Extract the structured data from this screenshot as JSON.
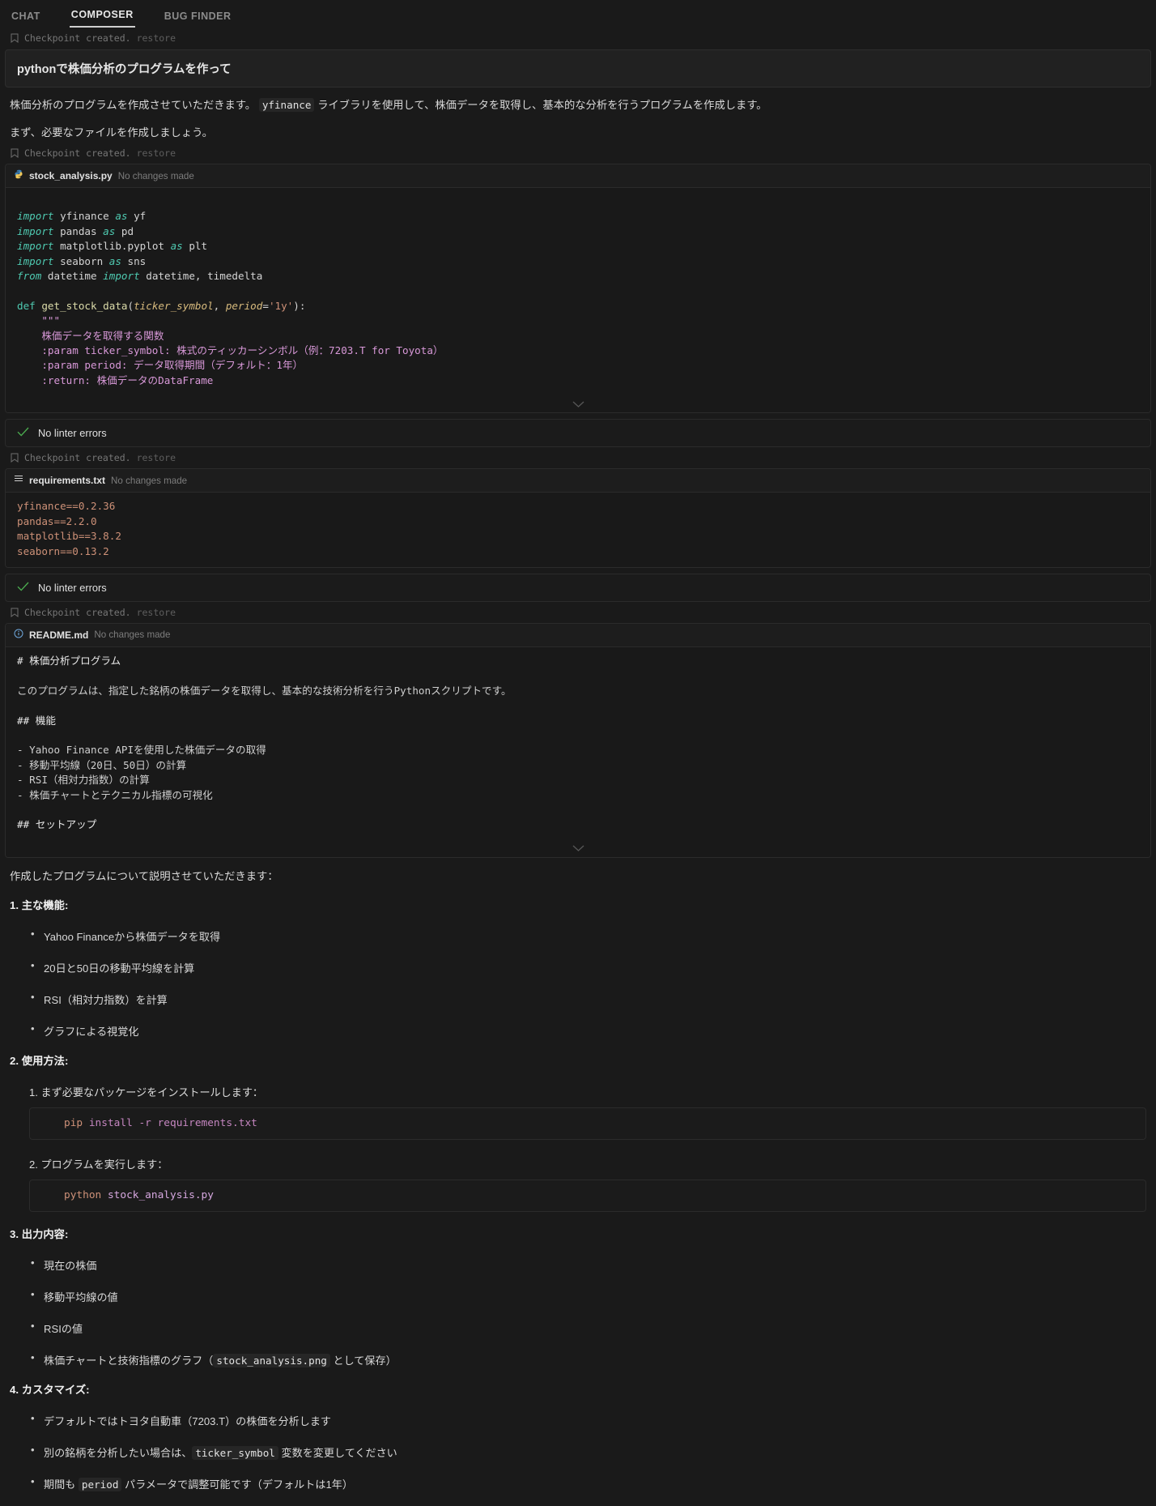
{
  "tabs": [
    {
      "label": "CHAT",
      "active": false
    },
    {
      "label": "COMPOSER",
      "active": true
    },
    {
      "label": "BUG FINDER",
      "active": false
    }
  ],
  "checkpoint": {
    "text": "Checkpoint created.",
    "restore": "restore"
  },
  "prompt": {
    "value": "pythonで株価分析のプログラムを作って"
  },
  "intro": {
    "line1_a": "株価分析のプログラムを作成させていただきます。",
    "line1_code": "yfinance",
    "line1_b": "ライブラリを使用して、株価データを取得し、基本的な分析を行うプログラムを作成します。",
    "line2": "まず、必要なファイルを作成しましょう。"
  },
  "files": [
    {
      "name": "stock_analysis.py",
      "status": "No changes made",
      "icon": "python-icon",
      "lines": [
        [
          {
            "t": "import",
            "c": "kw"
          },
          {
            "t": " yfinance ",
            "c": "pln"
          },
          {
            "t": "as",
            "c": "kw"
          },
          {
            "t": " yf",
            "c": "pln"
          }
        ],
        [
          {
            "t": "import",
            "c": "kw"
          },
          {
            "t": " pandas ",
            "c": "pln"
          },
          {
            "t": "as",
            "c": "kw"
          },
          {
            "t": " pd",
            "c": "pln"
          }
        ],
        [
          {
            "t": "import",
            "c": "kw"
          },
          {
            "t": " matplotlib.pyplot ",
            "c": "pln"
          },
          {
            "t": "as",
            "c": "kw"
          },
          {
            "t": " plt",
            "c": "pln"
          }
        ],
        [
          {
            "t": "import",
            "c": "kw"
          },
          {
            "t": " seaborn ",
            "c": "pln"
          },
          {
            "t": "as",
            "c": "kw"
          },
          {
            "t": " sns",
            "c": "pln"
          }
        ],
        [
          {
            "t": "from",
            "c": "kw"
          },
          {
            "t": " datetime ",
            "c": "pln"
          },
          {
            "t": "import",
            "c": "kw"
          },
          {
            "t": " datetime, timedelta",
            "c": "pln"
          }
        ],
        [],
        [
          {
            "t": "def ",
            "c": "kw2"
          },
          {
            "t": "get_stock_data",
            "c": "fn"
          },
          {
            "t": "(",
            "c": "pln"
          },
          {
            "t": "ticker_symbol",
            "c": "par"
          },
          {
            "t": ", ",
            "c": "pln"
          },
          {
            "t": "period",
            "c": "par"
          },
          {
            "t": "=",
            "c": "op"
          },
          {
            "t": "'1y'",
            "c": "str"
          },
          {
            "t": "):",
            "c": "pln"
          }
        ],
        [
          {
            "t": "    \"\"\"",
            "c": "doc"
          }
        ],
        [
          {
            "t": "    株価データを取得する関数",
            "c": "doc"
          }
        ],
        [
          {
            "t": "    :param ticker_symbol: 株式のティッカーシンボル（例：7203.T for Toyota）",
            "c": "doc"
          }
        ],
        [
          {
            "t": "    :param period: データ取得期間（デフォルト：1年）",
            "c": "doc"
          }
        ],
        [
          {
            "t": "    :return: 株価データのDataFrame",
            "c": "doc"
          }
        ]
      ],
      "collapsible": true
    },
    {
      "name": "requirements.txt",
      "status": "No changes made",
      "icon": "text-file-icon",
      "lines": [
        [
          {
            "t": "yfinance==0.2.36",
            "c": "pkg"
          }
        ],
        [
          {
            "t": "pandas==2.2.0",
            "c": "pkg"
          }
        ],
        [
          {
            "t": "matplotlib==3.8.2",
            "c": "pkg"
          }
        ],
        [
          {
            "t": "seaborn==0.13.2",
            "c": "pkg"
          }
        ]
      ],
      "collapsible": false
    },
    {
      "name": "README.md",
      "status": "No changes made",
      "icon": "info-icon",
      "lines": [
        [
          {
            "t": "# 株価分析プログラム",
            "c": "mdh"
          }
        ],
        [],
        [
          {
            "t": "このプログラムは、指定した銘柄の株価データを取得し、基本的な技術分析を行うPythonスクリプトです。",
            "c": "mdt"
          }
        ],
        [],
        [
          {
            "t": "## 機能",
            "c": "mdh"
          }
        ],
        [],
        [
          {
            "t": "- Yahoo Finance APIを使用した株価データの取得",
            "c": "mdt"
          }
        ],
        [
          {
            "t": "- 移動平均線（20日、50日）の計算",
            "c": "mdt"
          }
        ],
        [
          {
            "t": "- RSI（相対力指数）の計算",
            "c": "mdt"
          }
        ],
        [
          {
            "t": "- 株価チャートとテクニカル指標の可視化",
            "c": "mdt"
          }
        ],
        [],
        [
          {
            "t": "## セットアップ",
            "c": "mdh"
          }
        ]
      ],
      "collapsible": true
    }
  ],
  "linter": {
    "label": "No linter errors",
    "check_color": "#4caf50"
  },
  "explanation": {
    "intro": "作成したプログラムについて説明させていただきます：",
    "sections": [
      {
        "num": "1.",
        "title": "主な機能:",
        "bullets": [
          "Yahoo Financeから株価データを取得",
          "20日と50日の移動平均線を計算",
          "RSI（相対力指数）を計算",
          "グラフによる視覚化"
        ]
      },
      {
        "num": "2.",
        "title": "使用方法:",
        "steps": [
          {
            "label": "1. まず必要なパッケージをインストールします：",
            "cmd_a": "pip",
            "cmd_b": "install -r requirements.txt"
          },
          {
            "label": "2. プログラムを実行します：",
            "cmd_a": "python",
            "cmd_b": "stock_analysis.py"
          }
        ]
      },
      {
        "num": "3.",
        "title": "出力内容:",
        "bullets": [
          "現在の株価",
          "移動平均線の値",
          "RSIの値"
        ],
        "bullet_last": {
          "pre": "株価チャートと技術指標のグラフ（",
          "code": "stock_analysis.png",
          "post": " として保存）"
        }
      },
      {
        "num": "4.",
        "title": "カスタマイズ:",
        "bullets_rich": [
          {
            "pre": "デフォルトではトヨタ自動車（7203.T）の株価を分析します",
            "code": "",
            "post": ""
          },
          {
            "pre": "別の銘柄を分析したい場合は、",
            "code": "ticker_symbol",
            "post": " 変数を変更してください"
          },
          {
            "pre": "期間も ",
            "code": "period",
            "post": " パラメータで調整可能です（デフォルトは1年）"
          }
        ]
      }
    ]
  }
}
